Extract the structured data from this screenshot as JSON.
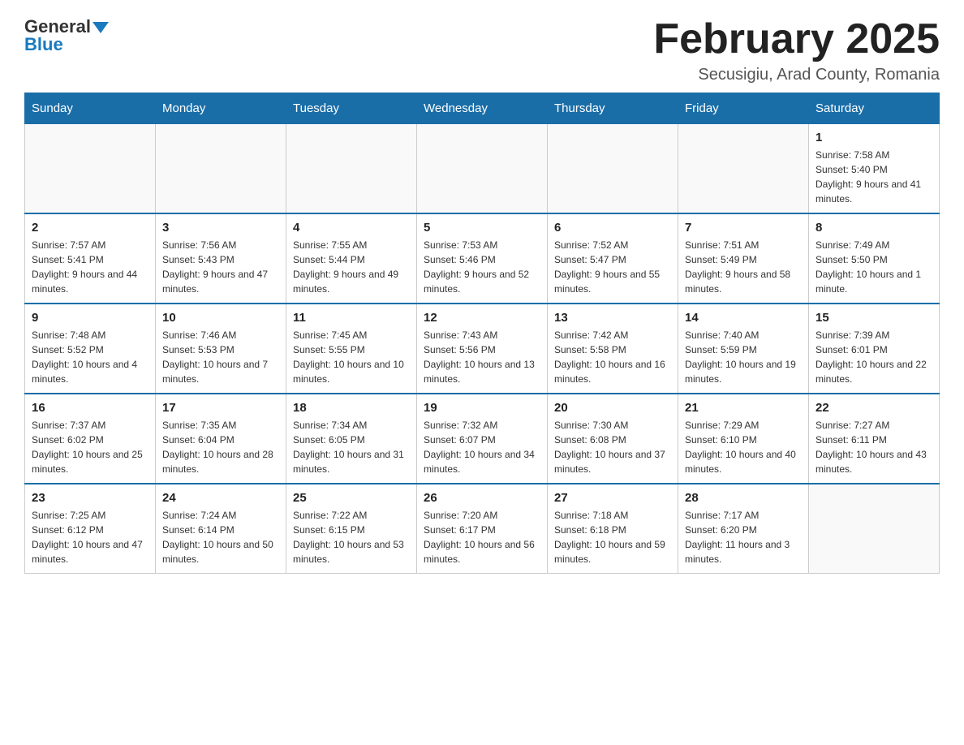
{
  "header": {
    "logo_general": "General",
    "logo_blue": "Blue",
    "month_title": "February 2025",
    "location": "Secusigiu, Arad County, Romania"
  },
  "weekdays": [
    "Sunday",
    "Monday",
    "Tuesday",
    "Wednesday",
    "Thursday",
    "Friday",
    "Saturday"
  ],
  "weeks": [
    [
      {
        "day": "",
        "info": ""
      },
      {
        "day": "",
        "info": ""
      },
      {
        "day": "",
        "info": ""
      },
      {
        "day": "",
        "info": ""
      },
      {
        "day": "",
        "info": ""
      },
      {
        "day": "",
        "info": ""
      },
      {
        "day": "1",
        "info": "Sunrise: 7:58 AM\nSunset: 5:40 PM\nDaylight: 9 hours and 41 minutes."
      }
    ],
    [
      {
        "day": "2",
        "info": "Sunrise: 7:57 AM\nSunset: 5:41 PM\nDaylight: 9 hours and 44 minutes."
      },
      {
        "day": "3",
        "info": "Sunrise: 7:56 AM\nSunset: 5:43 PM\nDaylight: 9 hours and 47 minutes."
      },
      {
        "day": "4",
        "info": "Sunrise: 7:55 AM\nSunset: 5:44 PM\nDaylight: 9 hours and 49 minutes."
      },
      {
        "day": "5",
        "info": "Sunrise: 7:53 AM\nSunset: 5:46 PM\nDaylight: 9 hours and 52 minutes."
      },
      {
        "day": "6",
        "info": "Sunrise: 7:52 AM\nSunset: 5:47 PM\nDaylight: 9 hours and 55 minutes."
      },
      {
        "day": "7",
        "info": "Sunrise: 7:51 AM\nSunset: 5:49 PM\nDaylight: 9 hours and 58 minutes."
      },
      {
        "day": "8",
        "info": "Sunrise: 7:49 AM\nSunset: 5:50 PM\nDaylight: 10 hours and 1 minute."
      }
    ],
    [
      {
        "day": "9",
        "info": "Sunrise: 7:48 AM\nSunset: 5:52 PM\nDaylight: 10 hours and 4 minutes."
      },
      {
        "day": "10",
        "info": "Sunrise: 7:46 AM\nSunset: 5:53 PM\nDaylight: 10 hours and 7 minutes."
      },
      {
        "day": "11",
        "info": "Sunrise: 7:45 AM\nSunset: 5:55 PM\nDaylight: 10 hours and 10 minutes."
      },
      {
        "day": "12",
        "info": "Sunrise: 7:43 AM\nSunset: 5:56 PM\nDaylight: 10 hours and 13 minutes."
      },
      {
        "day": "13",
        "info": "Sunrise: 7:42 AM\nSunset: 5:58 PM\nDaylight: 10 hours and 16 minutes."
      },
      {
        "day": "14",
        "info": "Sunrise: 7:40 AM\nSunset: 5:59 PM\nDaylight: 10 hours and 19 minutes."
      },
      {
        "day": "15",
        "info": "Sunrise: 7:39 AM\nSunset: 6:01 PM\nDaylight: 10 hours and 22 minutes."
      }
    ],
    [
      {
        "day": "16",
        "info": "Sunrise: 7:37 AM\nSunset: 6:02 PM\nDaylight: 10 hours and 25 minutes."
      },
      {
        "day": "17",
        "info": "Sunrise: 7:35 AM\nSunset: 6:04 PM\nDaylight: 10 hours and 28 minutes."
      },
      {
        "day": "18",
        "info": "Sunrise: 7:34 AM\nSunset: 6:05 PM\nDaylight: 10 hours and 31 minutes."
      },
      {
        "day": "19",
        "info": "Sunrise: 7:32 AM\nSunset: 6:07 PM\nDaylight: 10 hours and 34 minutes."
      },
      {
        "day": "20",
        "info": "Sunrise: 7:30 AM\nSunset: 6:08 PM\nDaylight: 10 hours and 37 minutes."
      },
      {
        "day": "21",
        "info": "Sunrise: 7:29 AM\nSunset: 6:10 PM\nDaylight: 10 hours and 40 minutes."
      },
      {
        "day": "22",
        "info": "Sunrise: 7:27 AM\nSunset: 6:11 PM\nDaylight: 10 hours and 43 minutes."
      }
    ],
    [
      {
        "day": "23",
        "info": "Sunrise: 7:25 AM\nSunset: 6:12 PM\nDaylight: 10 hours and 47 minutes."
      },
      {
        "day": "24",
        "info": "Sunrise: 7:24 AM\nSunset: 6:14 PM\nDaylight: 10 hours and 50 minutes."
      },
      {
        "day": "25",
        "info": "Sunrise: 7:22 AM\nSunset: 6:15 PM\nDaylight: 10 hours and 53 minutes."
      },
      {
        "day": "26",
        "info": "Sunrise: 7:20 AM\nSunset: 6:17 PM\nDaylight: 10 hours and 56 minutes."
      },
      {
        "day": "27",
        "info": "Sunrise: 7:18 AM\nSunset: 6:18 PM\nDaylight: 10 hours and 59 minutes."
      },
      {
        "day": "28",
        "info": "Sunrise: 7:17 AM\nSunset: 6:20 PM\nDaylight: 11 hours and 3 minutes."
      },
      {
        "day": "",
        "info": ""
      }
    ]
  ]
}
